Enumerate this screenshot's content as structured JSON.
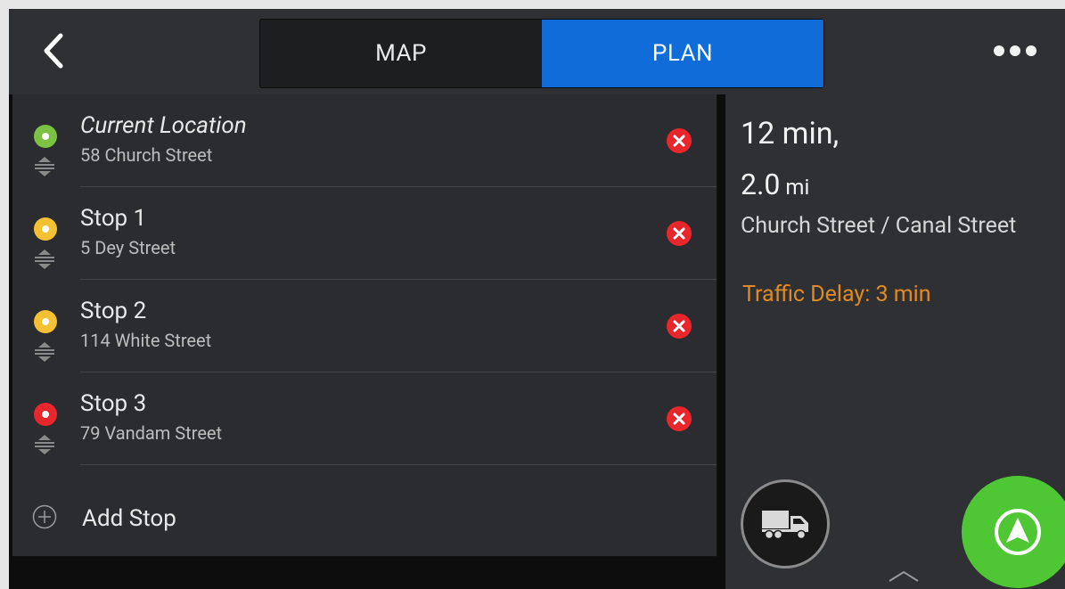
{
  "header": {
    "tabs": [
      {
        "label": "MAP",
        "active": false
      },
      {
        "label": "PLAN",
        "active": true
      }
    ],
    "accent_color": "#0f6cd9"
  },
  "stops": [
    {
      "title": "Current Location",
      "address": "58 Church Street",
      "pin_color": "#7cc242",
      "italic": true
    },
    {
      "title": "Stop 1",
      "address": "5 Dey Street",
      "pin_color": "#f5c133",
      "italic": false
    },
    {
      "title": "Stop 2",
      "address": "114 White Street",
      "pin_color": "#f5c133",
      "italic": false
    },
    {
      "title": "Stop 3",
      "address": "79 Vandam Street",
      "pin_color": "#e8262b",
      "italic": false
    }
  ],
  "add_stop_label": "Add Stop",
  "summary": {
    "time": "12 min,",
    "distance_value": "2.0",
    "distance_unit": "mi",
    "via": "Church Street / Canal Street",
    "traffic_delay": "Traffic Delay: 3 min",
    "delay_color": "#e08a25"
  },
  "icons": {
    "back": "chevron-left-icon",
    "more": "more-horizontal-icon",
    "remove": "close-circle-icon",
    "reorder": "drag-handle-icon",
    "add": "plus-circle-icon",
    "truck": "truck-icon",
    "expand": "chevron-up-icon",
    "navigate": "navigation-arrow-icon"
  },
  "go_button_color": "#4fc734"
}
